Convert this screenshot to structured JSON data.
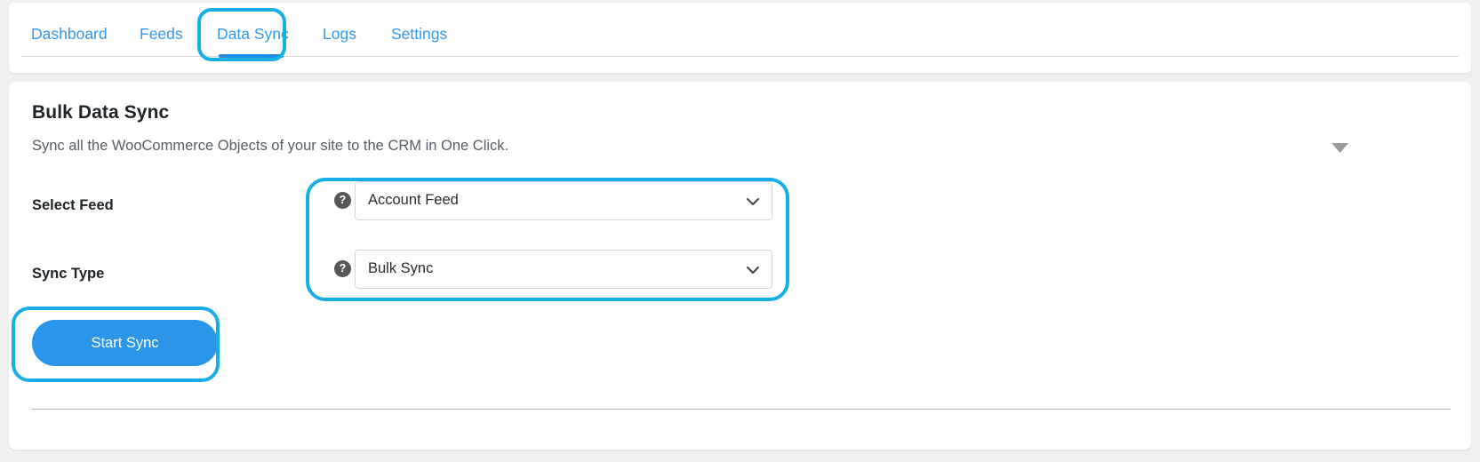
{
  "nav": {
    "tabs": [
      {
        "id": "dashboard",
        "label": "Dashboard",
        "active": false
      },
      {
        "id": "feeds",
        "label": "Feeds",
        "active": false
      },
      {
        "id": "data-sync",
        "label": "Data Sync",
        "active": true
      },
      {
        "id": "logs",
        "label": "Logs",
        "active": false
      },
      {
        "id": "settings",
        "label": "Settings",
        "active": false
      }
    ],
    "active_tab_label": "Data Sync",
    "link_color": "#3498ec",
    "active_underline_color": "#1f8ce0"
  },
  "panel": {
    "title": "Bulk Data Sync",
    "subtitle": "Sync all the WooCommerce Objects of your site to the CRM in One Click.",
    "collapse_icon": "caret-down-icon"
  },
  "form": {
    "select_feed": {
      "label": "Select Feed",
      "help_icon": "question-mark-icon",
      "help_glyph": "?",
      "value": "Account Feed",
      "chevron_icon": "chevron-down-icon"
    },
    "sync_type": {
      "label": "Sync Type",
      "help_icon": "question-mark-icon",
      "help_glyph": "?",
      "value": "Bulk Sync",
      "chevron_icon": "chevron-down-icon"
    },
    "start_button": {
      "label": "Start Sync",
      "color": "#2b95e9"
    }
  },
  "annotations": {
    "highlight_color": "#18aee6",
    "boxes": [
      {
        "name": "data-sync-tab-highlight"
      },
      {
        "name": "select-fields-highlight"
      },
      {
        "name": "start-sync-button-highlight"
      }
    ]
  }
}
